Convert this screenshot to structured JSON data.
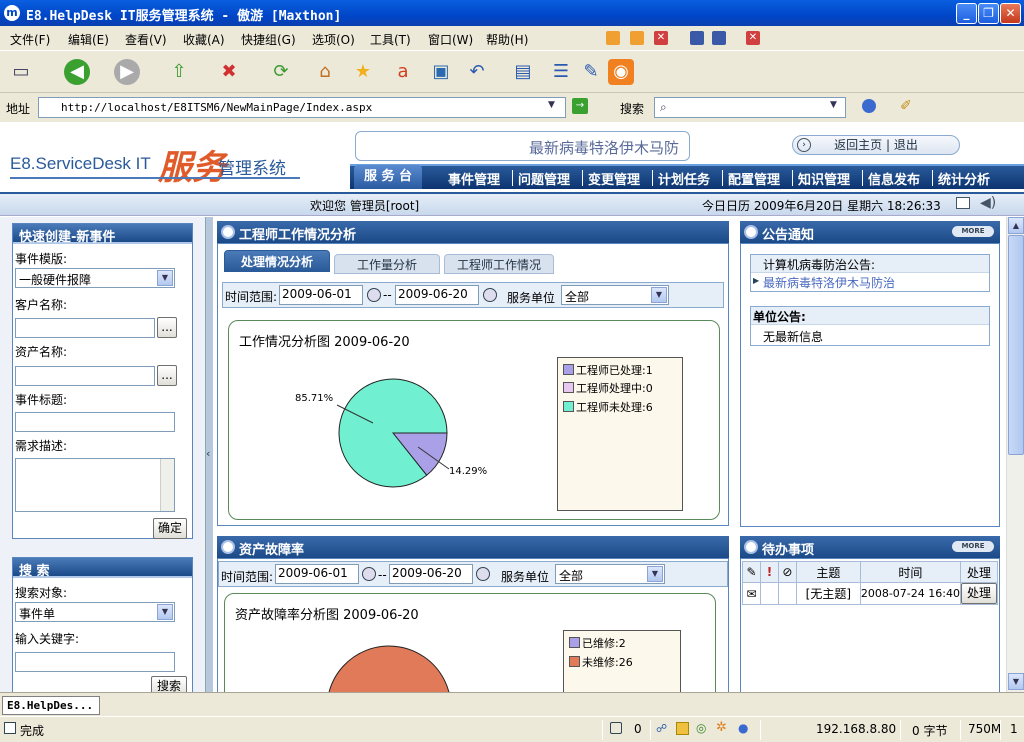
{
  "window": {
    "title": "E8.HelpDesk IT服务管理系统 - 傲游 [Maxthon]",
    "app_icon": "m"
  },
  "menu": [
    "文件(F)",
    "编辑(E)",
    "查看(V)",
    "收藏(A)",
    "快捷组(G)",
    "选项(O)",
    "工具(T)",
    "窗口(W)",
    "帮助(H)"
  ],
  "address": {
    "label": "地址",
    "url": "http://localhost/E8ITSM6/NewMainPage/Index.aspx",
    "search_label": "搜索"
  },
  "header": {
    "logo_prefix": "E8.ServiceDesk IT",
    "logo_accent": "服务",
    "logo_suffix": "管理系统",
    "banner": "最新病毒特洛伊木马防",
    "home_link": "返回主页 | 退出"
  },
  "nav": [
    "服 务 台",
    "事件管理",
    "问题管理",
    "变更管理",
    "计划任务",
    "配置管理",
    "知识管理",
    "信息发布",
    "统计分析"
  ],
  "welcome": {
    "greeting": "欢迎您 管理员[root]",
    "calendar": "今日日历 2009年6月20日 星期六 18:26:33"
  },
  "quick_create": {
    "title": "快速创建-新事件",
    "template_label": "事件模版:",
    "template_value": "一般硬件报障",
    "customer_label": "客户名称:",
    "asset_label": "资产名称:",
    "subject_label": "事件标题:",
    "desc_label": "需求描述:",
    "confirm": "确定",
    "browse": "..."
  },
  "search_panel": {
    "title": "搜 索",
    "target_label": "搜索对象:",
    "target_value": "事件单",
    "keyword_label": "输入关键字:",
    "search_btn": "搜索"
  },
  "engineer": {
    "title": "工程师工作情况分析",
    "tabs": [
      "处理情况分析",
      "工作量分析",
      "工程师工作情况"
    ],
    "range_label": "时间范围:",
    "from": "2009-06-01",
    "sep": "--",
    "to": "2009-06-20",
    "unit_label": "服务单位",
    "unit_value": "全部",
    "chart_title": "工作情况分析图 2009-06-20"
  },
  "asset": {
    "title": "资产故障率",
    "range_label": "时间范围:",
    "from": "2009-06-01",
    "sep": "--",
    "to": "2009-06-20",
    "unit_label": "服务单位",
    "unit_value": "全部",
    "chart_title": "资产故障率分析图 2009-06-20"
  },
  "notice": {
    "title": "公告通知",
    "more": "MORE",
    "sec1": "计算机病毒防治公告:",
    "item1": "最新病毒特洛伊木马防治",
    "sec2": "单位公告:",
    "item2": "无最新信息"
  },
  "todo": {
    "title": "待办事项",
    "more": "MORE",
    "headers": [
      "主题",
      "时间",
      "处理"
    ],
    "row": {
      "subject": "[无主题]",
      "time": "2008-07-24 16:40",
      "action": "处理"
    }
  },
  "status": {
    "ready": "完成",
    "count": "0",
    "ip": "192.168.8.80",
    "bytes": "0 字节",
    "mem": "750M",
    "num": "1",
    "tab_label": "E8.HelpDes..."
  },
  "chart_data": [
    {
      "type": "pie",
      "title": "工作情况分析图 2009-06-20",
      "labels": [
        "工程师已处理:1",
        "工程师处理中:0",
        "工程师未处理:6"
      ],
      "values": [
        1,
        0,
        6
      ],
      "colors": [
        "#aaa0e8",
        "#e8c8f0",
        "#70f0d0"
      ],
      "annotations": [
        "85.71%",
        "14.29%"
      ]
    },
    {
      "type": "pie",
      "title": "资产故障率分析图 2009-06-20",
      "labels": [
        "已维修:2",
        "未维修:26"
      ],
      "values": [
        2,
        26
      ],
      "colors": [
        "#aaa0e8",
        "#e07a58"
      ]
    }
  ]
}
